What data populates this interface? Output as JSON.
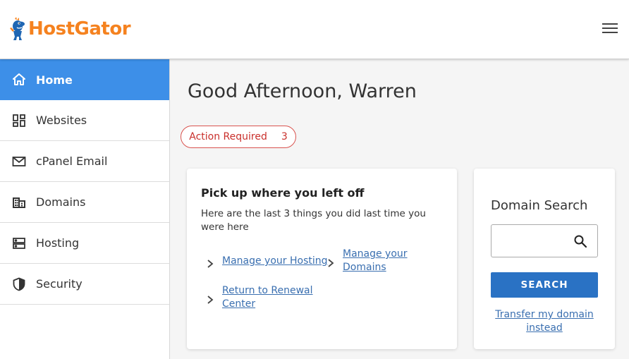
{
  "brand": {
    "name": "HostGator",
    "color": "#f5821f"
  },
  "header": {
    "menu_icon": "hamburger-menu-icon"
  },
  "sidebar": {
    "active_color": "#3d8fe8",
    "items": [
      {
        "label": "Home",
        "icon": "home-icon",
        "active": true
      },
      {
        "label": "Websites",
        "icon": "dashboard-grid-icon"
      },
      {
        "label": "cPanel Email",
        "icon": "envelope-icon"
      },
      {
        "label": "Domains",
        "icon": "building-icon"
      },
      {
        "label": "Hosting",
        "icon": "server-icon"
      },
      {
        "label": "Security",
        "icon": "shield-icon"
      }
    ]
  },
  "main": {
    "greeting": "Good Afternoon, Warren",
    "action_required": {
      "label": "Action Required",
      "count": "3",
      "color": "#d9534f"
    },
    "recent_card": {
      "title": "Pick up where you left off",
      "description": "Here are the last 3 things you did last time you were here",
      "links": [
        "Manage your Hosting",
        "Manage your Domains",
        "Return to Renewal Center"
      ]
    },
    "domain_search": {
      "title": "Domain Search",
      "input_value": "",
      "button_label": "SEARCH",
      "button_color": "#2a72c4",
      "transfer_link": "Transfer my domain instead"
    }
  }
}
